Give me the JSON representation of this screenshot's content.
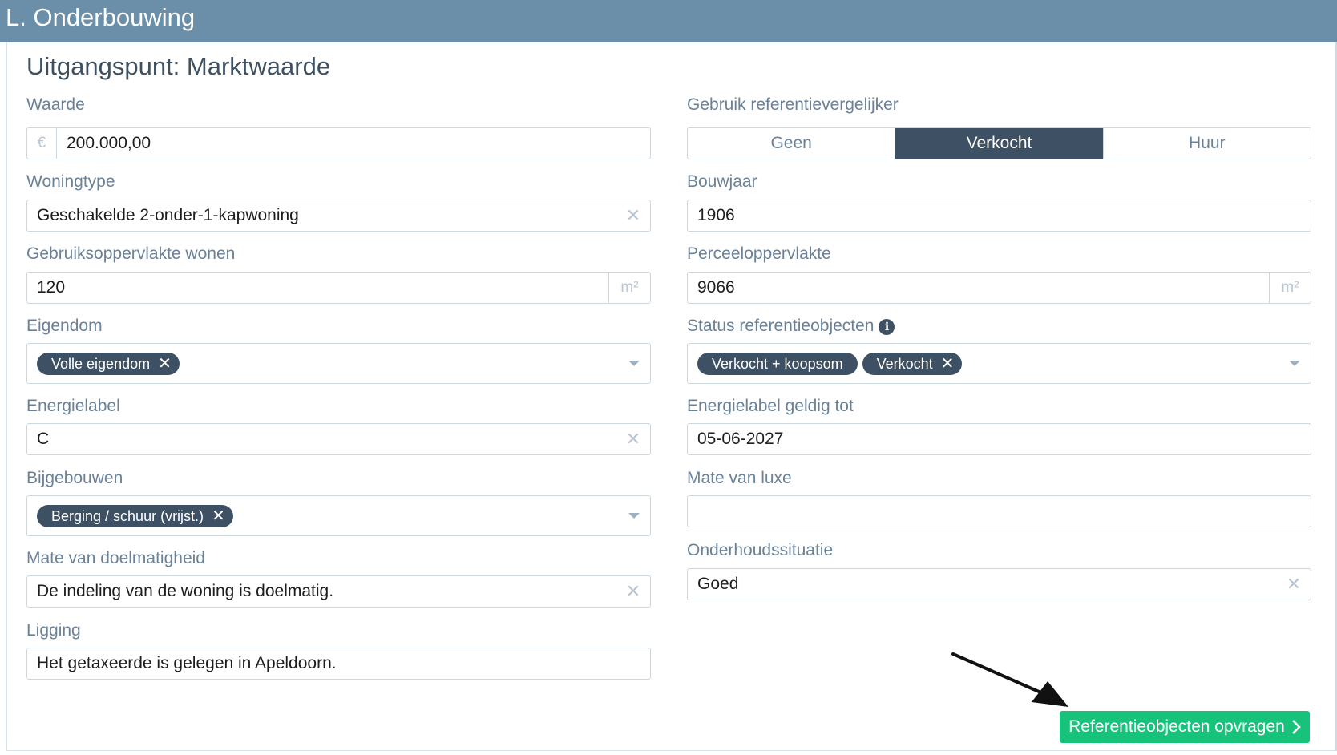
{
  "header": {
    "title": "L. Onderbouwing"
  },
  "card": {
    "title": "Uitgangspunt: Marktwaarde"
  },
  "fields": {
    "waarde": {
      "label": "Waarde",
      "prefix": "€",
      "value": "200.000,00"
    },
    "gebruik_ref": {
      "label": "Gebruik referentievergelijker",
      "options": [
        "Geen",
        "Verkocht",
        "Huur"
      ],
      "selected": "Verkocht"
    },
    "woningtype": {
      "label": "Woningtype",
      "value": "Geschakelde 2-onder-1-kapwoning"
    },
    "bouwjaar": {
      "label": "Bouwjaar",
      "value": "1906"
    },
    "gebruiksoppervlakte": {
      "label": "Gebruiksoppervlakte wonen",
      "value": "120",
      "unit": "m²"
    },
    "perceeloppervlakte": {
      "label": "Perceeloppervlakte",
      "value": "9066",
      "unit": "m²"
    },
    "eigendom": {
      "label": "Eigendom",
      "tags": [
        "Volle eigendom"
      ]
    },
    "status_ref": {
      "label": "Status referentieobjecten",
      "tags": [
        "Verkocht + koopsom",
        "Verkocht"
      ]
    },
    "energielabel": {
      "label": "Energielabel",
      "value": "C"
    },
    "energielabel_geldig": {
      "label": "Energielabel geldig tot",
      "value": "05-06-2027"
    },
    "bijgebouwen": {
      "label": "Bijgebouwen",
      "tags": [
        "Berging / schuur (vrijst.)"
      ]
    },
    "mate_luxe": {
      "label": "Mate van luxe",
      "value": ""
    },
    "doelmatigheid": {
      "label": "Mate van doelmatigheid",
      "value": "De indeling van de woning is doelmatig."
    },
    "onderhoud": {
      "label": "Onderhoudssituatie",
      "value": "Goed"
    },
    "ligging": {
      "label": "Ligging",
      "value": "Het getaxeerde is gelegen in Apeldoorn."
    }
  },
  "button": {
    "label": "Referentieobjecten opvragen",
    "color": "#17c37b"
  },
  "icons": {
    "clear": "close-icon",
    "dropdown": "caret-down-icon",
    "info": "info-icon",
    "chevron": "chevron-right-icon"
  },
  "colors": {
    "header": "#6b8fa8",
    "accent_dark": "#3e5164",
    "label": "#6b8196"
  }
}
